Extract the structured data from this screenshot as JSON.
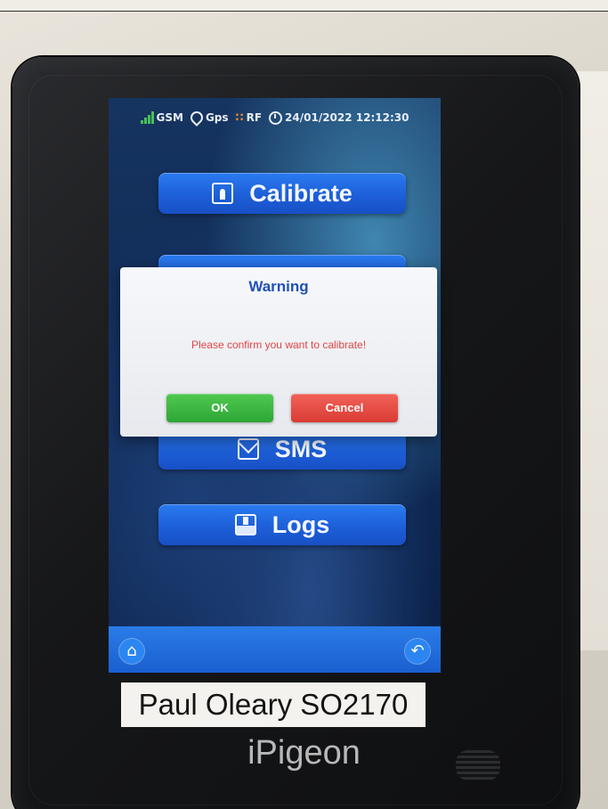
{
  "status_bar": {
    "gsm": "GSM",
    "gps": "Gps",
    "rf": "RF",
    "datetime": "24/01/2022 12:12:30"
  },
  "menu": {
    "calibrate": "Calibrate",
    "sms": "SMS",
    "logs": "Logs"
  },
  "dialog": {
    "title": "Warning",
    "message": "Please confirm you want to calibrate!",
    "ok": "OK",
    "cancel": "Cancel"
  },
  "nav": {
    "home_icon": "home-icon",
    "back_icon": "back-icon"
  },
  "device": {
    "label": "Paul Oleary SO2170",
    "brand": "iPigeon"
  },
  "colors": {
    "accent": "#1d5fd8",
    "warning_title": "#2050b8",
    "warning_text": "#e04545",
    "ok": "#2fa636",
    "cancel": "#d93b34"
  }
}
